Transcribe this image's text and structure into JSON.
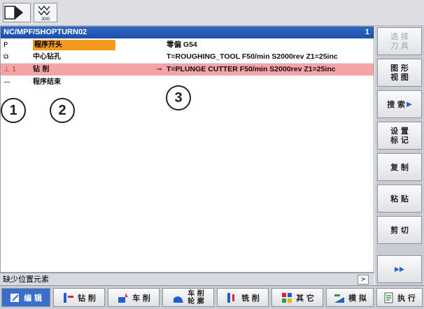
{
  "topbar": {
    "jog_label": "JOG"
  },
  "path": {
    "title": "NC/MPF/SHOPTURN02",
    "number": "1"
  },
  "rows": [
    {
      "symbol": "P",
      "name": "程序开头",
      "detail": "零偏 G54"
    },
    {
      "symbol": "⧉",
      "name": "中心钻孔",
      "detail": "T=ROUGHING_TOOL F50/min S2000rev Z1=25inc"
    },
    {
      "symbol": "⊥ 1",
      "name": "钻 削",
      "detail": "T=PLUNGE CUTTER F50/min S2000rev Z1=25inc",
      "marker": "⊸"
    },
    {
      "symbol": "—",
      "name": "程序结束",
      "detail": ""
    }
  ],
  "callouts": [
    "1",
    "2",
    "3"
  ],
  "status": {
    "message": "缺少位置元素",
    "scroll": ">"
  },
  "softkeys": [
    "选 择\n刀 具",
    "图 形\n视 图",
    "搜 索",
    "设 置\n标 记",
    "复 制",
    "粘 贴",
    "剪 切",
    "▸▸"
  ],
  "bottom": [
    {
      "label": "编 辑"
    },
    {
      "label": "钻 削"
    },
    {
      "label": "车 削"
    },
    {
      "label": "车 削\n轮 廓"
    },
    {
      "label": "铣 削"
    },
    {
      "label": "其 它"
    },
    {
      "label": "模 拟"
    },
    {
      "label": "执 行"
    }
  ],
  "colors": {
    "accent_blue": "#1f4fa8",
    "highlight_orange": "#f39a1e",
    "highlight_pink": "#f4a3a8"
  }
}
